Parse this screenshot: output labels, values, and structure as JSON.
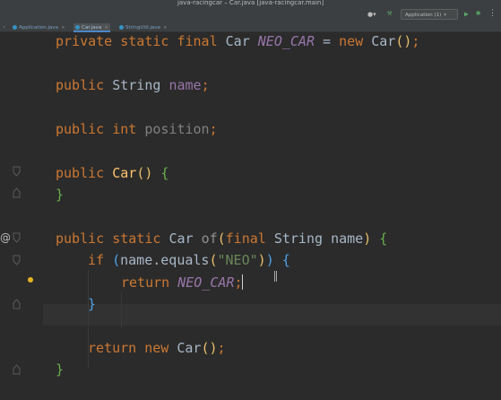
{
  "window": {
    "title": "java-racingcar – Car.java [java-racingcar.main]"
  },
  "toolbar": {
    "user_icon": "user-icon",
    "user_caret": "▾",
    "build_icon": "hammer-icon",
    "run_config_label": "Application (1)",
    "run_config_caret": "▾",
    "run_icon": "run-icon",
    "debug_icon": "debug-icon",
    "more_icon": "more-icon"
  },
  "tabs": [
    {
      "label": "Application.java",
      "active": false
    },
    {
      "label": "Car.java",
      "active": true
    },
    {
      "label": "StringUtil.java",
      "active": false
    }
  ],
  "gutter": {
    "override_marker": "@"
  },
  "code": {
    "line1": {
      "t1": "private static final ",
      "t2": "Car ",
      "t3": "NEO_CAR",
      "t4": " = ",
      "t5": "new ",
      "t6": "Car",
      "t7": "(",
      "t8": ")",
      "t9": ";"
    },
    "line2": {
      "t1": "public ",
      "t2": "String ",
      "t3": "name",
      "t4": ";"
    },
    "line3": {
      "t1": "public int ",
      "t2": "position",
      "t3": ";"
    },
    "line4": {
      "t1": "public ",
      "t2": "Car",
      "t3": "() ",
      "t4": "{"
    },
    "line5": {
      "t1": "}"
    },
    "line6": {
      "t1": "public static ",
      "t2": "Car ",
      "t3": "of",
      "t4": "(",
      "t5": "final ",
      "t6": "String ",
      "t7": "name",
      "t8": ") ",
      "t9": "{"
    },
    "line7": {
      "t1": "if ",
      "t2": "(",
      "t3": "name.equals",
      "t4": "(",
      "t5": "\"NEO\"",
      "t6": ")",
      "t7": ") ",
      "t8": "{"
    },
    "line8": {
      "t1": "return ",
      "t2": "NEO_CAR",
      "t3": ";"
    },
    "line9": {
      "t1": "}"
    },
    "line10": {
      "t1": "return new ",
      "t2": "Car",
      "t3": "()",
      "t4": ";"
    },
    "line11": {
      "t1": "}"
    }
  }
}
